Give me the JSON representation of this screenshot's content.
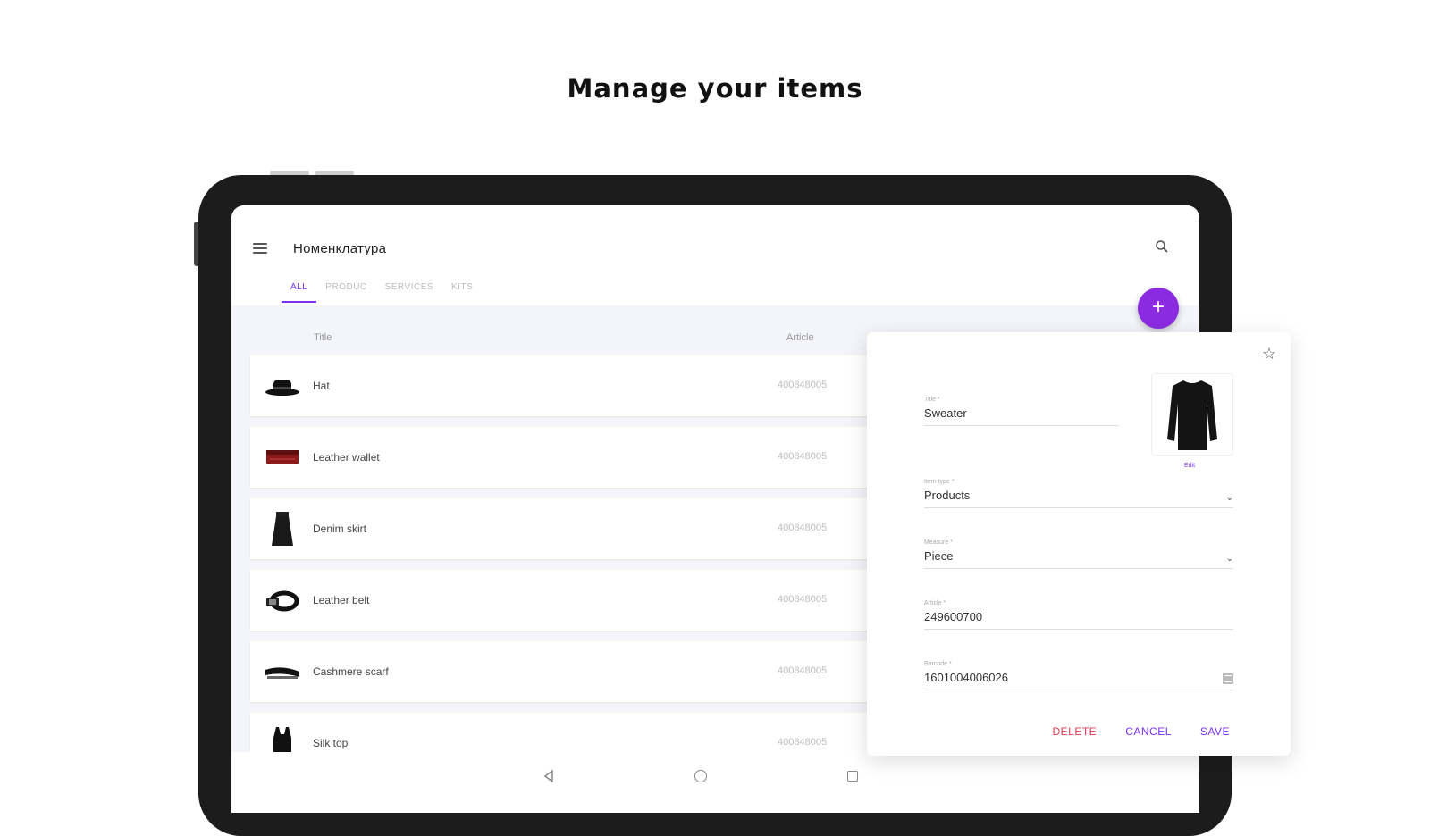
{
  "headline": "Manage your items",
  "app": {
    "title": "Номенклатура",
    "tabs": [
      "ALL",
      "PRODUC",
      "SERVICES",
      "KITS"
    ],
    "active_tab": 0,
    "fab_label": "+"
  },
  "list": {
    "col_title": "Title",
    "col_article": "Article",
    "rows": [
      {
        "name": "Hat",
        "article": "400848005",
        "icon": "hat-icon"
      },
      {
        "name": "Leather wallet",
        "article": "400848005",
        "icon": "wallet-icon"
      },
      {
        "name": "Denim skirt",
        "article": "400848005",
        "icon": "skirt-icon"
      },
      {
        "name": "Leather belt",
        "article": "400848005",
        "icon": "belt-icon"
      },
      {
        "name": "Cashmere scarf",
        "article": "400848005",
        "icon": "scarf-icon"
      },
      {
        "name": "Silk top",
        "article": "400848005",
        "icon": "top-icon"
      }
    ]
  },
  "card": {
    "title_label": "Title *",
    "title_value": "Sweater",
    "photo_link": "Edit",
    "type_label": "Item type *",
    "type_value": "Products",
    "measure_label": "Measure *",
    "measure_value": "Piece",
    "article_label": "Article *",
    "article_value": "249600700",
    "barcode_label": "Barcode *",
    "barcode_value": "1601004006026",
    "delete_label": "DELETE",
    "cancel_label": "CANCEL",
    "save_label": "SAVE"
  },
  "colors": {
    "accent": "#7b2ff7",
    "fab": "#8a2be2",
    "delete": "#e53950",
    "list_bg": "#f4f5fa"
  }
}
